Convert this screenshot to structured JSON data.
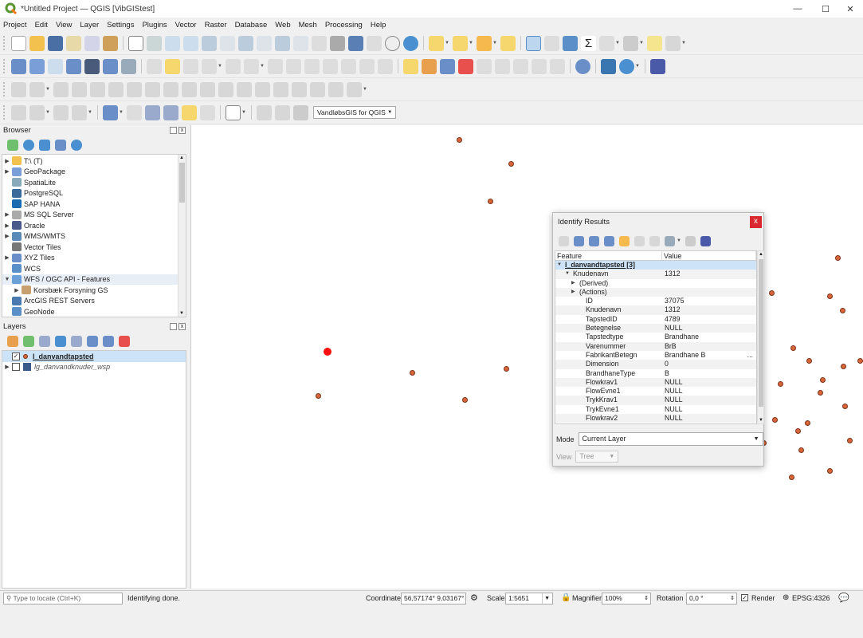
{
  "window": {
    "title": "*Untitled Project — QGIS [VibGIStest]",
    "controls": [
      "—",
      "☐",
      "✕"
    ]
  },
  "menu": [
    "Project",
    "Edit",
    "View",
    "Layer",
    "Settings",
    "Plugins",
    "Vector",
    "Raster",
    "Database",
    "Web",
    "Mesh",
    "Processing",
    "Help"
  ],
  "toolbar": {
    "plugin_combo": "VandløbsGIS for QGIS"
  },
  "browser": {
    "title": "Browser",
    "items": [
      {
        "label": "T:\\ (T)",
        "expand": "▶",
        "icon": "folder-icon"
      },
      {
        "label": "GeoPackage",
        "expand": "▶",
        "icon": "geopackage-icon"
      },
      {
        "label": "SpatiaLite",
        "expand": "",
        "icon": "spatialite-icon"
      },
      {
        "label": "PostgreSQL",
        "expand": "",
        "icon": "postgresql-icon"
      },
      {
        "label": "SAP HANA",
        "expand": "",
        "icon": "sap-hana-icon"
      },
      {
        "label": "MS SQL Server",
        "expand": "▶",
        "icon": "mssql-icon"
      },
      {
        "label": "Oracle",
        "expand": "▶",
        "icon": "oracle-icon"
      },
      {
        "label": "WMS/WMTS",
        "expand": "▶",
        "icon": "wms-icon"
      },
      {
        "label": "Vector Tiles",
        "expand": "",
        "icon": "vector-tiles-icon"
      },
      {
        "label": "XYZ Tiles",
        "expand": "▶",
        "icon": "xyz-tiles-icon"
      },
      {
        "label": "WCS",
        "expand": "",
        "icon": "wcs-icon"
      },
      {
        "label": "WFS / OGC API - Features",
        "expand": "▼",
        "icon": "wfs-icon"
      },
      {
        "label": "Korsbæk Forsyning GS",
        "expand": "▶",
        "icon": "connection-icon",
        "indent": true
      },
      {
        "label": "ArcGIS REST Servers",
        "expand": "",
        "icon": "arcgis-icon"
      },
      {
        "label": "GeoNode",
        "expand": "",
        "icon": "geonode-icon"
      }
    ]
  },
  "layers": {
    "title": "Layers",
    "items": [
      {
        "label": "l_danvandtapsted",
        "checked": true,
        "active": true
      },
      {
        "label": "lg_danvandknuder_wsp",
        "checked": false,
        "active": false
      }
    ]
  },
  "identify": {
    "title": "Identify Results",
    "col_feature": "Feature",
    "col_value": "Value",
    "rows": [
      {
        "f": "l_danvandtapsted  [3]",
        "v": "",
        "lvl": 0,
        "arrow": "▼",
        "bold": true
      },
      {
        "f": "Knudenavn",
        "v": "1312",
        "lvl": 1,
        "arrow": "▼"
      },
      {
        "f": "(Derived)",
        "v": "",
        "lvl": 2,
        "arrow": "▶"
      },
      {
        "f": "(Actions)",
        "v": "",
        "lvl": 2,
        "arrow": "▶"
      },
      {
        "f": "ID",
        "v": "37075",
        "lvl": 3
      },
      {
        "f": "Knudenavn",
        "v": "1312",
        "lvl": 3
      },
      {
        "f": "TapstedID",
        "v": "4789",
        "lvl": 3
      },
      {
        "f": "Betegnelse",
        "v": "NULL",
        "lvl": 3
      },
      {
        "f": "Tapstedtype",
        "v": "Brandhane",
        "lvl": 3
      },
      {
        "f": "Varenummer",
        "v": "BrB",
        "lvl": 3
      },
      {
        "f": "FabrikantBetegn",
        "v": "Brandhane B",
        "lvl": 3,
        "more": "..."
      },
      {
        "f": "Dimension",
        "v": "0",
        "lvl": 3
      },
      {
        "f": "BrandhaneType",
        "v": "B",
        "lvl": 3
      },
      {
        "f": "Flowkrav1",
        "v": "NULL",
        "lvl": 3
      },
      {
        "f": "FlowEvne1",
        "v": "NULL",
        "lvl": 3
      },
      {
        "f": "TrykKrav1",
        "v": "NULL",
        "lvl": 3
      },
      {
        "f": "TrykEvne1",
        "v": "NULL",
        "lvl": 3
      },
      {
        "f": "Flowkrav2",
        "v": "NULL",
        "lvl": 3
      }
    ],
    "mode_label": "Mode",
    "mode_value": "Current Layer",
    "view_label": "View",
    "view_value": "Tree"
  },
  "status": {
    "locate_placeholder": "Type to locate (Ctrl+K)",
    "message": "Identifying done.",
    "coordinate_label": "Coordinate",
    "coordinate_value": "56,57174° 9,03167°",
    "scale_label": "Scale",
    "scale_value": "1:5651",
    "magnifier_label": "Magnifier",
    "magnifier_value": "100%",
    "rotation_label": "Rotation",
    "rotation_value": "0,0 °",
    "render_label": "Render",
    "crs": "EPSG:4326"
  },
  "colors": {
    "point_fill": "#d9663a",
    "selected_point": "#ff1010",
    "close_button": "#d9282f"
  }
}
